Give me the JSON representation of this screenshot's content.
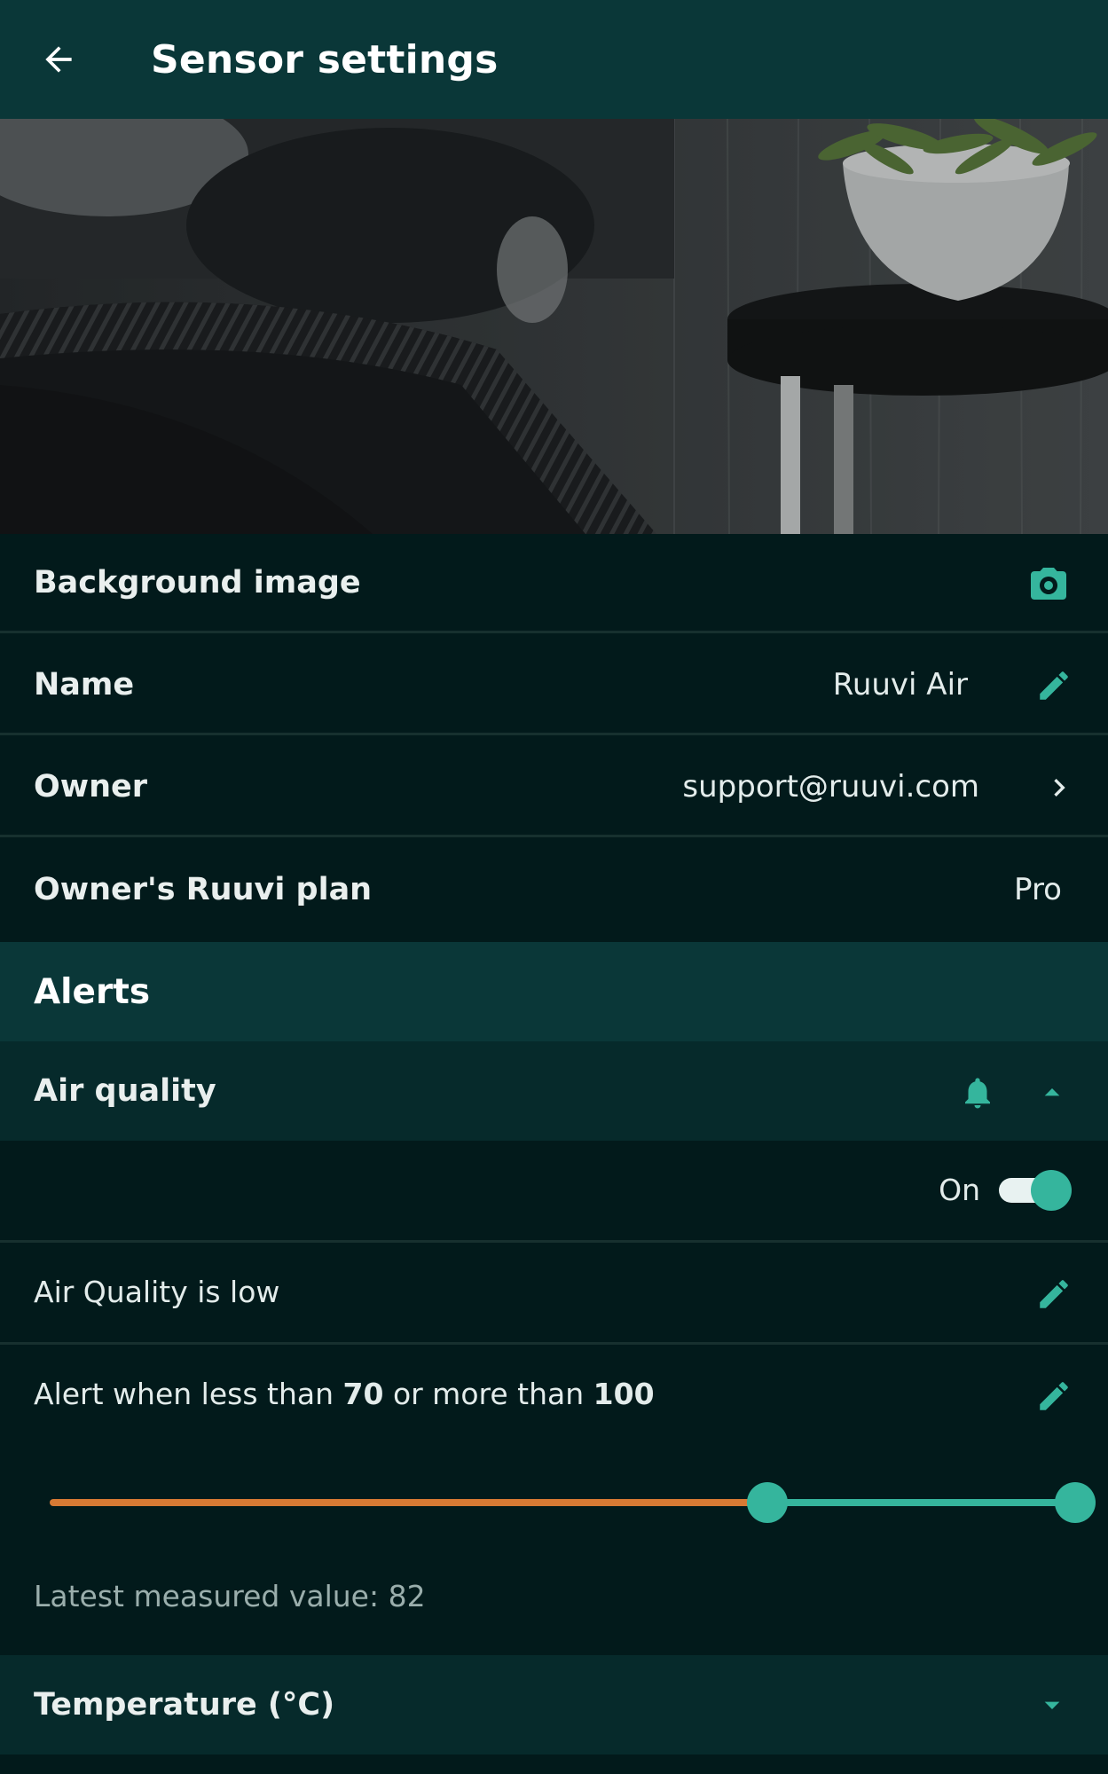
{
  "appbar": {
    "title": "Sensor settings"
  },
  "settings": {
    "background_image_label": "Background image",
    "name_label": "Name",
    "name_value": "Ruuvi Air",
    "owner_label": "Owner",
    "owner_value": "support@ruuvi.com",
    "plan_label": "Owner's Ruuvi plan",
    "plan_value": "Pro"
  },
  "alerts": {
    "section_title": "Alerts",
    "air_quality": {
      "title": "Air quality",
      "toggle_label": "On",
      "enabled": true,
      "description": "Air Quality is low",
      "range_prefix": "Alert when less than",
      "min": "70",
      "range_middle": "or more than",
      "max": "100",
      "slider_scale_min": 0,
      "slider_scale_max": 100,
      "latest_value_text": "Latest measured value: 82"
    },
    "temperature": {
      "title": "Temperature (°C)"
    }
  },
  "icons": {
    "back": "arrow-left-icon",
    "camera": "camera-icon",
    "edit": "pencil-icon",
    "chevron": "chevron-right-icon",
    "bell": "bell-icon",
    "collapse": "caret-up-icon",
    "expand": "caret-down-icon"
  },
  "colors": {
    "accent": "#35b59d",
    "alert_range": "#d77a34",
    "appbar": "#0a3738",
    "background": "#021a1b"
  }
}
